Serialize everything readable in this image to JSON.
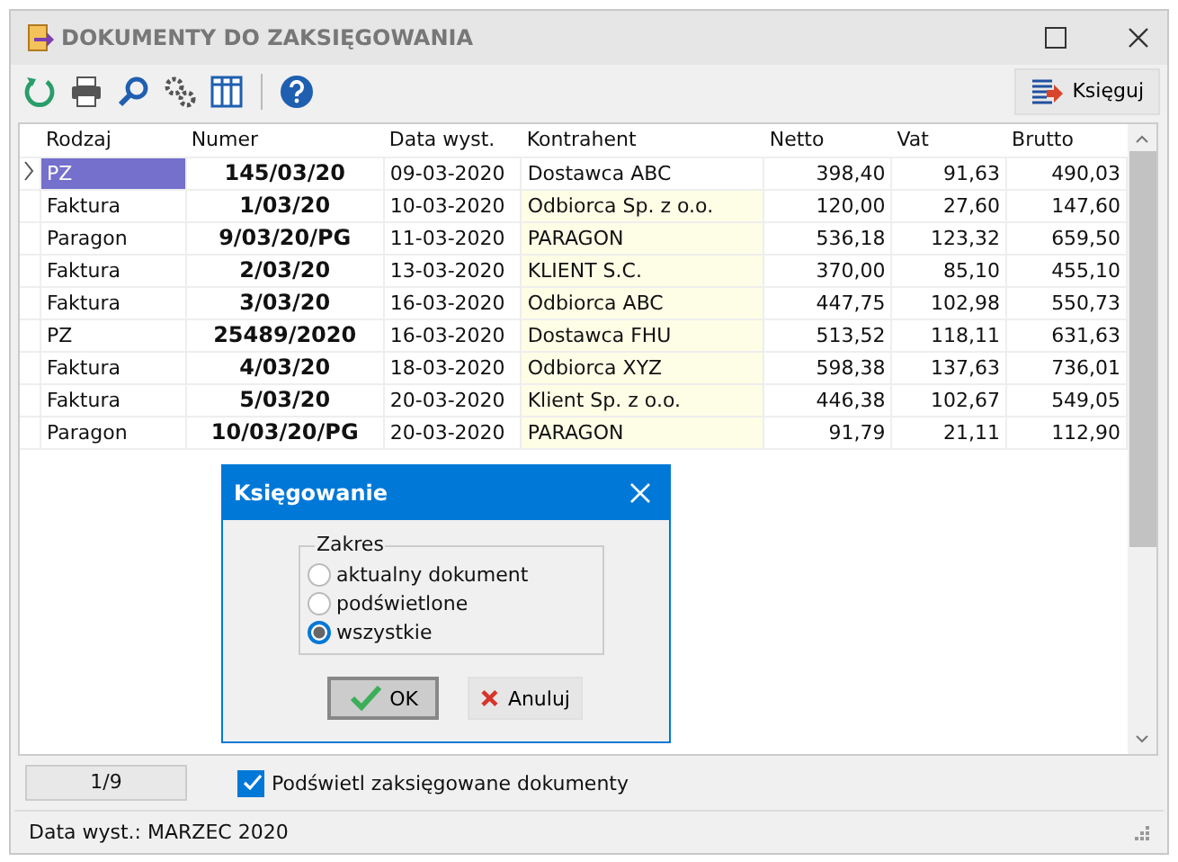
{
  "window": {
    "title": "DOKUMENTY DO ZAKSIĘGOWANIA"
  },
  "toolbar": {
    "post_button": "Księguj"
  },
  "table": {
    "columns": [
      "Rodzaj",
      "Numer",
      "Data wyst.",
      "Kontrahent",
      "Netto",
      "Vat",
      "Brutto"
    ],
    "rows": [
      {
        "selected": true,
        "cells": [
          "PZ",
          "145/03/20",
          "09-03-2020",
          "Dostawca ABC",
          "398,40",
          "91,63",
          "490,03"
        ]
      },
      {
        "selected": false,
        "cells": [
          "Faktura",
          "1/03/20",
          "10-03-2020",
          "Odbiorca Sp. z o.o.",
          "120,00",
          "27,60",
          "147,60"
        ]
      },
      {
        "selected": false,
        "cells": [
          "Paragon",
          "9/03/20/PG",
          "11-03-2020",
          "PARAGON",
          "536,18",
          "123,32",
          "659,50"
        ]
      },
      {
        "selected": false,
        "cells": [
          "Faktura",
          "2/03/20",
          "13-03-2020",
          "KLIENT S.C.",
          "370,00",
          "85,10",
          "455,10"
        ]
      },
      {
        "selected": false,
        "cells": [
          "Faktura",
          "3/03/20",
          "16-03-2020",
          "Odbiorca ABC",
          "447,75",
          "102,98",
          "550,73"
        ]
      },
      {
        "selected": false,
        "cells": [
          "PZ",
          "25489/2020",
          "16-03-2020",
          "Dostawca FHU",
          "513,52",
          "118,11",
          "631,63"
        ]
      },
      {
        "selected": false,
        "cells": [
          "Faktura",
          "4/03/20",
          "18-03-2020",
          "Odbiorca XYZ",
          "598,38",
          "137,63",
          "736,01"
        ]
      },
      {
        "selected": false,
        "cells": [
          "Faktura",
          "5/03/20",
          "20-03-2020",
          "Klient Sp. z o.o.",
          "446,38",
          "102,67",
          "549,05"
        ]
      },
      {
        "selected": false,
        "cells": [
          "Paragon",
          "10/03/20/PG",
          "20-03-2020",
          "PARAGON",
          "91,79",
          "21,11",
          "112,90"
        ]
      }
    ]
  },
  "dialog": {
    "title": "Księgowanie",
    "group_label": "Zakres",
    "options": [
      {
        "label": "aktualny dokument",
        "selected": false
      },
      {
        "label": "podświetlone",
        "selected": false
      },
      {
        "label": "wszystkie",
        "selected": true
      }
    ],
    "buttons": [
      {
        "kind": "ok",
        "label": "OK"
      },
      {
        "kind": "cancel",
        "label": "Anuluj"
      }
    ]
  },
  "footer": {
    "counter": "1/9",
    "highlight_checkbox": {
      "label": "Podświetl zaksięgowane dokumenty",
      "checked": true
    }
  },
  "status_bar": "Data wyst.: MARZEC 2020"
}
